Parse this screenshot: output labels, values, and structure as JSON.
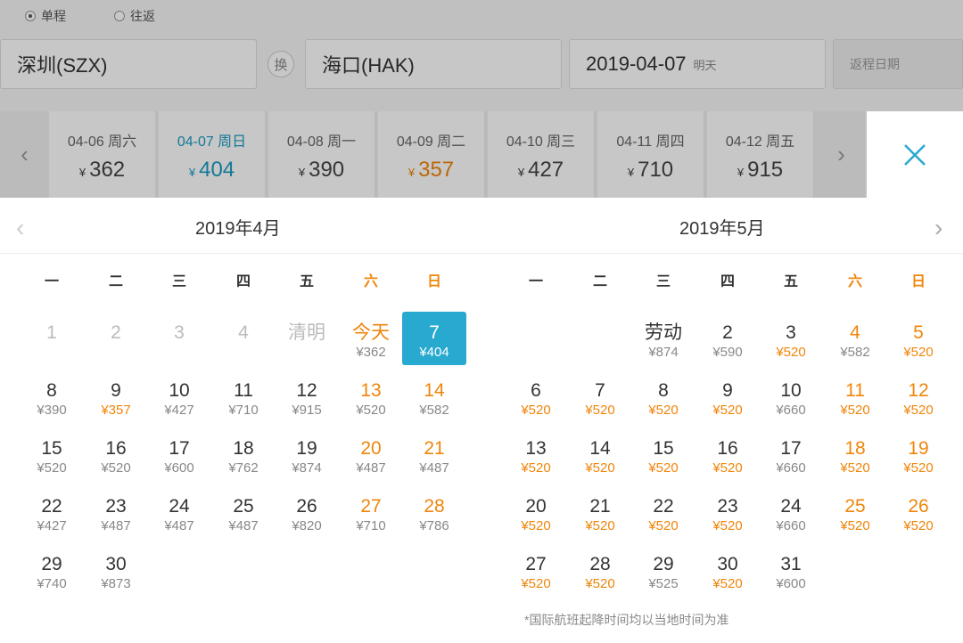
{
  "trip_type": {
    "one_way": "单程",
    "round_trip": "往返"
  },
  "search": {
    "from": "深圳(SZX)",
    "swap_label": "换",
    "to": "海口(HAK)",
    "date": "2019-04-07",
    "date_sub": "明天",
    "return_placeholder": "返程日期"
  },
  "date_strip": [
    {
      "date": "04-06 周六",
      "price": "362",
      "selected": false,
      "low": false
    },
    {
      "date": "04-07 周日",
      "price": "404",
      "selected": true,
      "low": false
    },
    {
      "date": "04-08 周一",
      "price": "390",
      "selected": false,
      "low": false
    },
    {
      "date": "04-09 周二",
      "price": "357",
      "selected": false,
      "low": true
    },
    {
      "date": "04-10 周三",
      "price": "427",
      "selected": false,
      "low": false
    },
    {
      "date": "04-11 周四",
      "price": "710",
      "selected": false,
      "low": false
    },
    {
      "date": "04-12 周五",
      "price": "915",
      "selected": false,
      "low": false
    }
  ],
  "currency": "¥",
  "weekdays": [
    "一",
    "二",
    "三",
    "四",
    "五",
    "六",
    "日"
  ],
  "months": [
    {
      "title": "2019年4月",
      "offset": 0,
      "days": [
        {
          "n": "1",
          "p": "",
          "past": true
        },
        {
          "n": "2",
          "p": "",
          "past": true
        },
        {
          "n": "3",
          "p": "",
          "past": true
        },
        {
          "n": "4",
          "p": "",
          "past": true
        },
        {
          "n": "清明",
          "p": "",
          "past": true
        },
        {
          "n": "今天",
          "p": "¥362",
          "today": true
        },
        {
          "n": "7",
          "p": "¥404",
          "sel": true
        },
        {
          "n": "8",
          "p": "¥390"
        },
        {
          "n": "9",
          "p": "¥357",
          "hl": true
        },
        {
          "n": "10",
          "p": "¥427"
        },
        {
          "n": "11",
          "p": "¥710"
        },
        {
          "n": "12",
          "p": "¥915"
        },
        {
          "n": "13",
          "p": "¥520"
        },
        {
          "n": "14",
          "p": "¥582"
        },
        {
          "n": "15",
          "p": "¥520"
        },
        {
          "n": "16",
          "p": "¥520"
        },
        {
          "n": "17",
          "p": "¥600"
        },
        {
          "n": "18",
          "p": "¥762"
        },
        {
          "n": "19",
          "p": "¥874"
        },
        {
          "n": "20",
          "p": "¥487"
        },
        {
          "n": "21",
          "p": "¥487"
        },
        {
          "n": "22",
          "p": "¥427"
        },
        {
          "n": "23",
          "p": "¥487"
        },
        {
          "n": "24",
          "p": "¥487"
        },
        {
          "n": "25",
          "p": "¥487"
        },
        {
          "n": "26",
          "p": "¥820"
        },
        {
          "n": "27",
          "p": "¥710"
        },
        {
          "n": "28",
          "p": "¥786"
        },
        {
          "n": "29",
          "p": "¥740"
        },
        {
          "n": "30",
          "p": "¥873"
        }
      ]
    },
    {
      "title": "2019年5月",
      "offset": 2,
      "days": [
        {
          "n": "劳动",
          "p": "¥874"
        },
        {
          "n": "2",
          "p": "¥590"
        },
        {
          "n": "3",
          "p": "¥520",
          "hl": true
        },
        {
          "n": "4",
          "p": "¥582"
        },
        {
          "n": "5",
          "p": "¥520",
          "hl": true
        },
        {
          "n": "6",
          "p": "¥520",
          "hl": true
        },
        {
          "n": "7",
          "p": "¥520",
          "hl": true
        },
        {
          "n": "8",
          "p": "¥520",
          "hl": true
        },
        {
          "n": "9",
          "p": "¥520",
          "hl": true
        },
        {
          "n": "10",
          "p": "¥660"
        },
        {
          "n": "11",
          "p": "¥520",
          "hl": true
        },
        {
          "n": "12",
          "p": "¥520",
          "hl": true
        },
        {
          "n": "13",
          "p": "¥520",
          "hl": true
        },
        {
          "n": "14",
          "p": "¥520",
          "hl": true
        },
        {
          "n": "15",
          "p": "¥520",
          "hl": true
        },
        {
          "n": "16",
          "p": "¥520",
          "hl": true
        },
        {
          "n": "17",
          "p": "¥660"
        },
        {
          "n": "18",
          "p": "¥520",
          "hl": true
        },
        {
          "n": "19",
          "p": "¥520",
          "hl": true
        },
        {
          "n": "20",
          "p": "¥520",
          "hl": true
        },
        {
          "n": "21",
          "p": "¥520",
          "hl": true
        },
        {
          "n": "22",
          "p": "¥520",
          "hl": true
        },
        {
          "n": "23",
          "p": "¥520",
          "hl": true
        },
        {
          "n": "24",
          "p": "¥660"
        },
        {
          "n": "25",
          "p": "¥520",
          "hl": true
        },
        {
          "n": "26",
          "p": "¥520",
          "hl": true
        },
        {
          "n": "27",
          "p": "¥520",
          "hl": true
        },
        {
          "n": "28",
          "p": "¥520",
          "hl": true
        },
        {
          "n": "29",
          "p": "¥525"
        },
        {
          "n": "30",
          "p": "¥520",
          "hl": true
        },
        {
          "n": "31",
          "p": "¥600"
        }
      ]
    }
  ],
  "footnote": "*国际航班起降时间均以当地时间为准",
  "colors": {
    "accent": "#27a9d0",
    "low_price": "#f0850a",
    "weekend": "#f0850a"
  }
}
